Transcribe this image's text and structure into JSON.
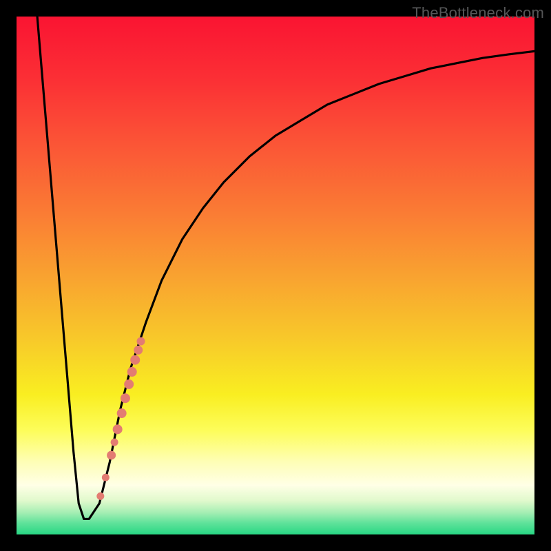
{
  "watermark": "TheBottleneck.com",
  "chart_data": {
    "type": "line",
    "title": "",
    "xlabel": "",
    "ylabel": "",
    "xlim": [
      0,
      100
    ],
    "ylim": [
      0,
      100
    ],
    "curve": {
      "name": "bottleneck-curve",
      "x": [
        4,
        5,
        6,
        7,
        8,
        9,
        10,
        11,
        12,
        13,
        14,
        16,
        18,
        20,
        22,
        25,
        28,
        32,
        36,
        40,
        45,
        50,
        55,
        60,
        65,
        70,
        75,
        80,
        85,
        90,
        95,
        100
      ],
      "y": [
        100,
        88,
        76,
        64,
        52,
        40,
        28,
        16,
        6,
        3,
        3,
        6,
        14,
        24,
        32,
        41,
        49,
        57,
        63,
        68,
        73,
        77,
        80,
        83,
        85,
        87,
        88.5,
        90,
        91,
        92,
        92.7,
        93.3
      ]
    },
    "green_band": {
      "y_start": 0,
      "y_end": 4.5
    },
    "highlight_points": [
      {
        "x": 16.2,
        "y": 7.4,
        "r": 5.5
      },
      {
        "x": 17.2,
        "y": 11.0,
        "r": 5.5
      },
      {
        "x": 18.3,
        "y": 15.3,
        "r": 6.5
      },
      {
        "x": 18.9,
        "y": 17.8,
        "r": 5.5
      },
      {
        "x": 19.5,
        "y": 20.3,
        "r": 7.0
      },
      {
        "x": 20.3,
        "y": 23.4,
        "r": 7.0
      },
      {
        "x": 21.0,
        "y": 26.3,
        "r": 7.0
      },
      {
        "x": 21.7,
        "y": 29.0,
        "r": 7.0
      },
      {
        "x": 22.3,
        "y": 31.4,
        "r": 7.0
      },
      {
        "x": 22.9,
        "y": 33.7,
        "r": 7.0
      },
      {
        "x": 23.5,
        "y": 35.6,
        "r": 6.5
      },
      {
        "x": 24.0,
        "y": 37.3,
        "r": 6.0
      }
    ],
    "point_color": "#e37c72",
    "background_gradient": {
      "stops": [
        {
          "offset": 0.0,
          "color": "#fa1432"
        },
        {
          "offset": 0.12,
          "color": "#fb2f35"
        },
        {
          "offset": 0.25,
          "color": "#fb5636"
        },
        {
          "offset": 0.38,
          "color": "#fa7c34"
        },
        {
          "offset": 0.5,
          "color": "#f9a230"
        },
        {
          "offset": 0.62,
          "color": "#f8c82a"
        },
        {
          "offset": 0.73,
          "color": "#f9ee21"
        },
        {
          "offset": 0.8,
          "color": "#fdfd5b"
        },
        {
          "offset": 0.86,
          "color": "#fefeb6"
        },
        {
          "offset": 0.905,
          "color": "#ffffe6"
        },
        {
          "offset": 0.935,
          "color": "#e0f9cc"
        },
        {
          "offset": 0.958,
          "color": "#a4eeb3"
        },
        {
          "offset": 0.978,
          "color": "#5fe29a"
        },
        {
          "offset": 1.0,
          "color": "#28d784"
        }
      ]
    }
  }
}
